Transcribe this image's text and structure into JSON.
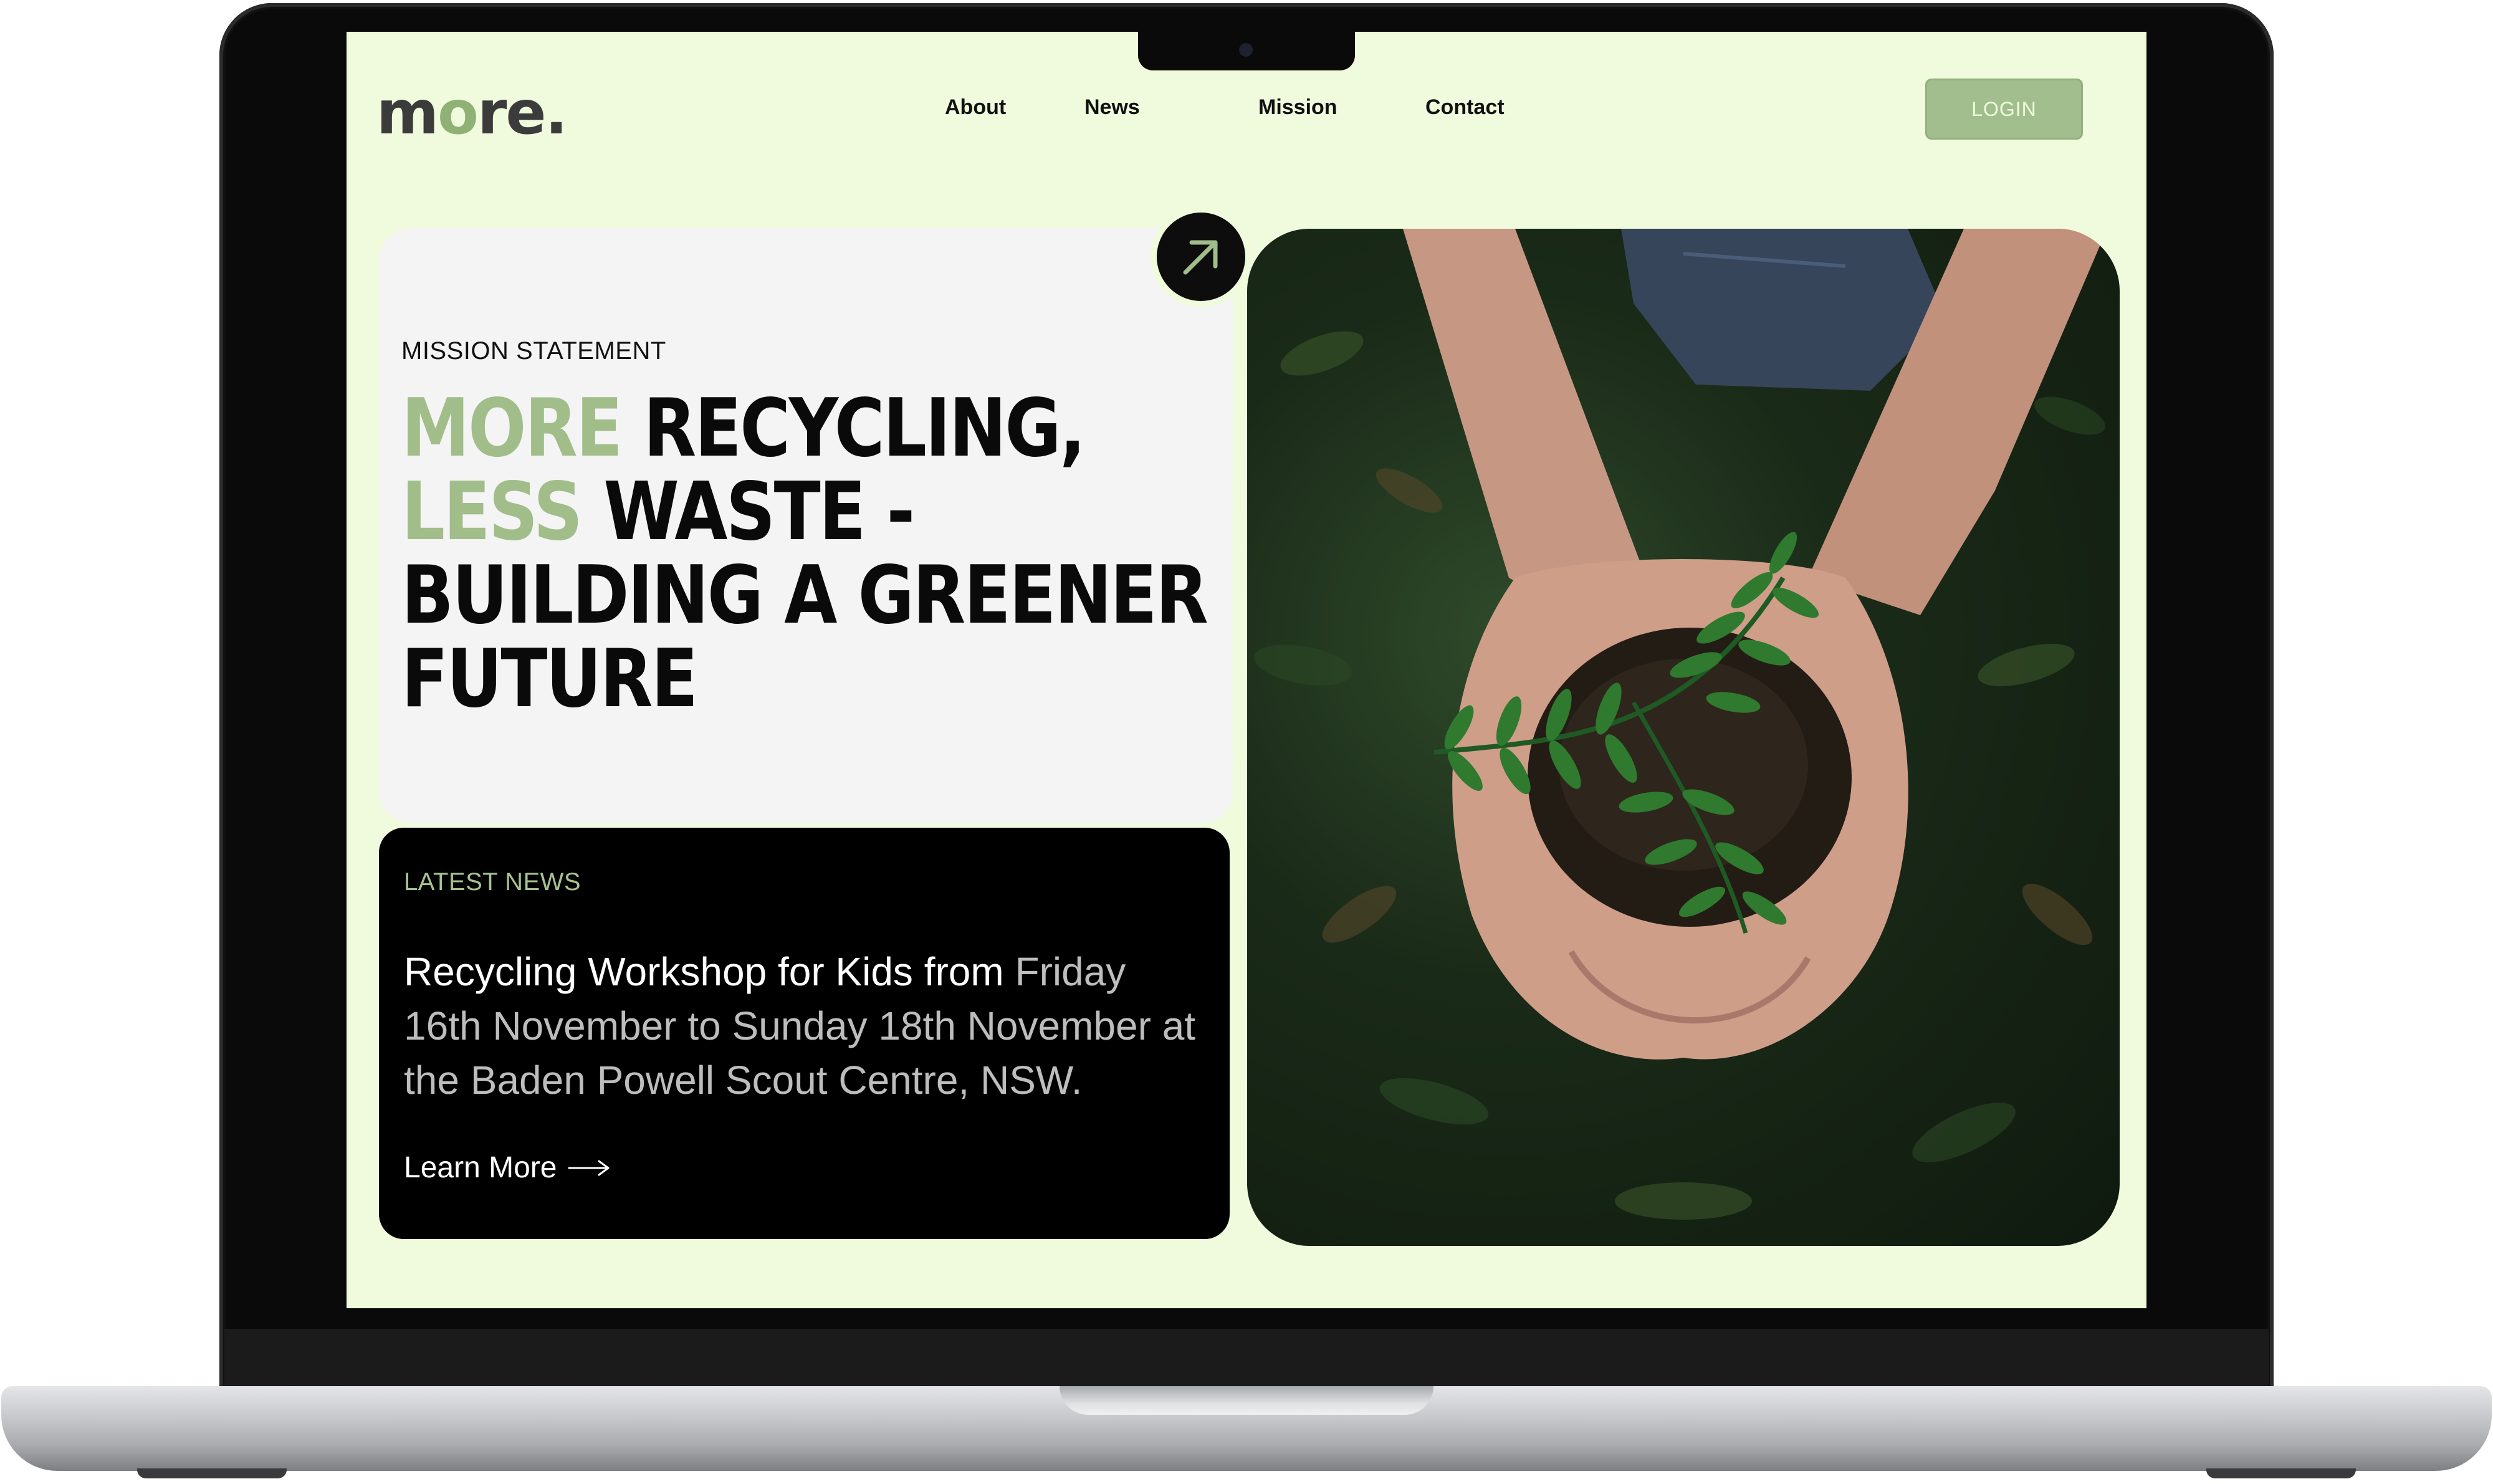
{
  "site": {
    "logo_pre": "m",
    "logo_o": "o",
    "logo_post": "re."
  },
  "nav": {
    "items": [
      "About",
      "News",
      "Mission",
      "Contact"
    ],
    "login_label": "LOGIN"
  },
  "mission": {
    "label": "MISSION STATEMENT",
    "headline": {
      "l1_accent": "MORE",
      "l1_rest": " RECYCLING,",
      "l2_accent": "LESS",
      "l2_rest": " WASTE -",
      "l3": "BUILDING A GREENER",
      "l4": "FUTURE"
    }
  },
  "news": {
    "label": "LATEST NEWS",
    "lead": "Recycling Workshop for Kids from",
    "rest": " Friday 16th November to Sunday 18th November at the Baden Powell Scout Centre, NSW.",
    "link_label": "Learn More"
  },
  "icons": {
    "arrow_up_right": "arrow-up-right-icon",
    "arrow_right": "arrow-right-icon",
    "camera": "camera-icon"
  },
  "colors": {
    "background": "#effbdc",
    "accent_green": "#a1bd8a",
    "login_button": "#a3be8e",
    "dark": "#000000",
    "card": "#f4f4f4"
  }
}
